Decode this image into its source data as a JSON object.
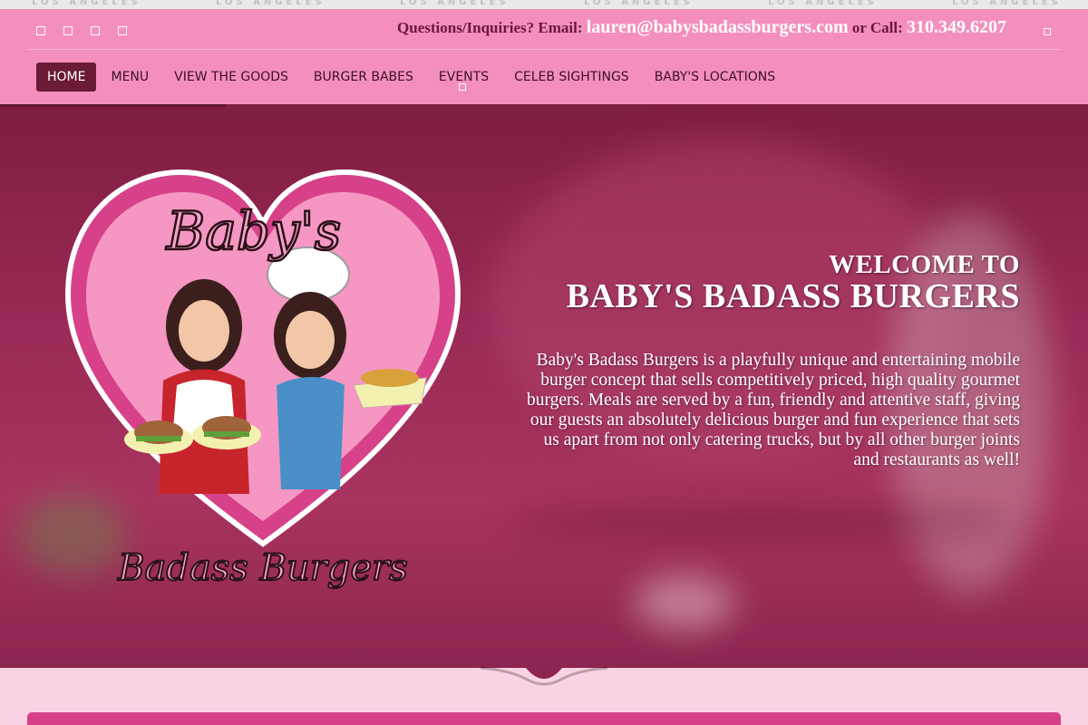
{
  "top_strip": {
    "text": "LOS ANGELES"
  },
  "header": {
    "social_icons": [
      "social-icon-1",
      "social-icon-2",
      "social-icon-3",
      "social-icon-4"
    ],
    "contact": {
      "prefix": "Questions/Inquiries? Email:",
      "email": "lauren@babysbadassburgers.com",
      "mid": "or Call:",
      "phone": "310.349.6207"
    }
  },
  "nav": {
    "items": [
      {
        "label": "HOME",
        "active": true
      },
      {
        "label": "MENU"
      },
      {
        "label": "VIEW THE GOODS"
      },
      {
        "label": "BURGER BABES"
      },
      {
        "label": "EVENTS"
      },
      {
        "label": "CELEB SIGHTINGS"
      },
      {
        "label": "BABY'S LOCATIONS"
      }
    ]
  },
  "hero": {
    "logo": {
      "top_text": "Baby's",
      "bottom_text": "Badass Burgers"
    },
    "welcome_line1": "WELCOME TO",
    "welcome_line2": "BABY'S BADASS BURGERS",
    "description": "Baby's Badass Burgers is a playfully unique and entertaining mobile burger concept that sells competitively priced, high quality gourmet burgers. Meals are served by a fun, friendly and attentive staff, giving our guests an absolutely delicious burger and fun experience that sets us apart from not only catering trucks, but by all other burger joints and restaurants as well!"
  },
  "colors": {
    "header_pink": "#f48fbd",
    "nav_active": "#6b1a37",
    "hero_magenta": "#9a2a57",
    "logo_heart": "#d7418a",
    "page_bg": "#f9d3e3"
  }
}
